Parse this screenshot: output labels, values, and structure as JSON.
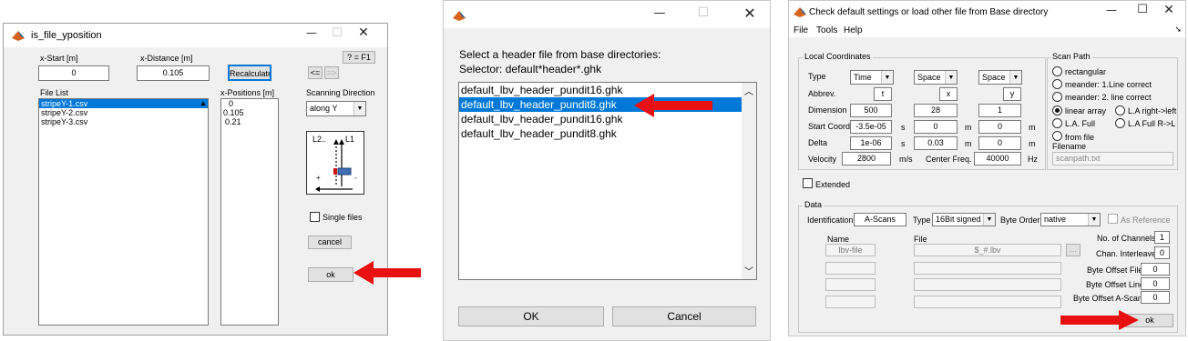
{
  "dialog1": {
    "title": "is_file_yposition",
    "help_button": "? = F1",
    "xstart_label": "x-Start [m]",
    "xstart_value": "0",
    "xdistance_label": "x-Distance [m]",
    "xdistance_value": "0.105",
    "recalculate_button": "Recalculate",
    "prev_button": "<=",
    "next_button": "=>",
    "file_list_label": "File List",
    "files": [
      "stripeY-1.csv",
      "stripeY-2.csv",
      "stripeY-3.csv"
    ],
    "xpositions_label": "x-Positions [m]",
    "xpositions": [
      "0",
      "0.105",
      "0.21"
    ],
    "scanning_direction_label": "Scanning Direction",
    "scanning_direction_value": "along Y",
    "diagram": {
      "l2_label": "L2..",
      "l1_label": "L1",
      "plus_label": "+",
      "minus_label": "-"
    },
    "single_files_label": "Single files",
    "cancel_button": "cancel",
    "ok_button": "ok"
  },
  "dialog2": {
    "prompt_line1": "Select a header file from base directories:",
    "prompt_line2": "Selector: default*header*.ghk",
    "files": [
      "default_lbv_header_pundit16.ghk",
      "default_lbv_header_pundit8.ghk",
      "default_lbv_header_pundit16.ghk",
      "default_lbv_header_pundit8.ghk"
    ],
    "selected_index": 1,
    "ok_button": "OK",
    "cancel_button": "Cancel"
  },
  "dialog3": {
    "title": "Check default settings or load other file from Base directory",
    "menu": [
      "File",
      "Tools",
      "Help"
    ],
    "local_coordinates": {
      "title": "Local Coordinates",
      "row_labels": [
        "Type",
        "Abbrev.",
        "Dimension",
        "Start Coord.",
        "Delta",
        "Velocity"
      ],
      "types": [
        "Time",
        "Space",
        "Space"
      ],
      "abbrev": [
        "t",
        "x",
        "y"
      ],
      "dimension": [
        "500",
        "28",
        "1"
      ],
      "start_coord": [
        "-3.5e-05",
        "0",
        "0"
      ],
      "start_units": [
        "s",
        "m",
        "m"
      ],
      "delta": [
        "1e-06",
        "0.03",
        "0"
      ],
      "delta_units": [
        "s",
        "m",
        "m"
      ],
      "velocity_value": "2800",
      "velocity_unit": "m/s",
      "center_freq_label": "Center Freq.",
      "center_freq_value": "40000",
      "center_freq_unit": "Hz"
    },
    "scan_path": {
      "title": "Scan Path",
      "options": [
        "rectangular",
        "meander: 1.Line correct",
        "meander: 2. line correct",
        "linear array",
        "L.A right->left",
        "L.A. Full",
        "L.A Full R->L",
        "from file"
      ],
      "selected": "linear array",
      "filename_label": "Filename",
      "filename_value": "scanpath.txt"
    },
    "extended_label": "Extended",
    "data": {
      "title": "Data",
      "identification_label": "Identification",
      "identification_value": "A-Scans",
      "type_label": "Type",
      "type_value": "16Bit signed",
      "byte_order_label": "Byte Order",
      "byte_order_value": "native",
      "as_reference_label": "As Reference",
      "name_header": "Name",
      "file_header": "File",
      "name_first": "lbv-file",
      "file_first": "$_#.lbv",
      "browse_button": "...",
      "right_fields": [
        {
          "label": "No. of Channels",
          "value": "1"
        },
        {
          "label": "Chan. Interleave",
          "value": "0"
        },
        {
          "label": "Byte Offset File",
          "value": "0"
        },
        {
          "label": "Byte Offset Line",
          "value": "0"
        },
        {
          "label": "Byte Offset A-Scan",
          "value": "0"
        }
      ]
    },
    "ok_button": "ok"
  },
  "colors": {
    "accent": "#0078d7",
    "arrow": "#e81010",
    "window_bg": "#f0f0f0"
  }
}
